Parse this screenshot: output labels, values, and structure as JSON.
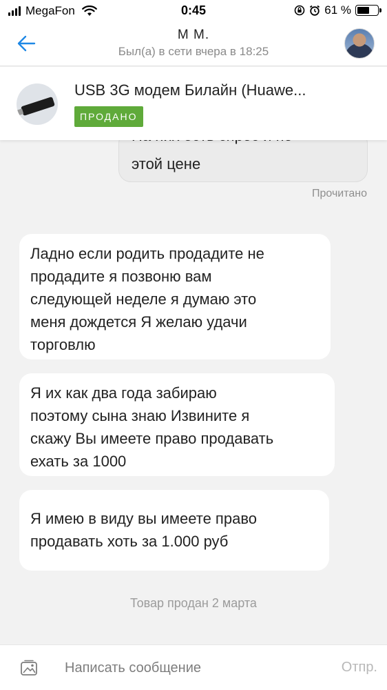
{
  "status_bar": {
    "carrier": "MegaFon",
    "time": "0:45",
    "battery": "61 %",
    "battery_level": 0.61
  },
  "header": {
    "title": "М М.",
    "subtitle": "Был(а) в сети вчера в 18:25"
  },
  "product": {
    "title": "USB 3G модем Билайн (Huawe...",
    "badge": "ПРОДАНО"
  },
  "messages": {
    "outgoing": {
      "line1": "На них есть спрос и по",
      "line2": "этой цене",
      "status": "Прочитано"
    },
    "incoming": [
      {
        "lines": [
          "Ладно если родить продадите не",
          "продадите я позвоню вам",
          "следующей неделе я думаю это",
          "меня дождется Я желаю удачи",
          "торговлю"
        ]
      },
      {
        "lines": [
          "Я их как два года забираю",
          "поэтому сына знаю Извините я",
          "скажу Вы имеете право продавать",
          "ехать за 1000"
        ]
      },
      {
        "lines": [
          "Я имею в виду вы имеете право",
          "продавать хоть за 1.000 руб"
        ]
      }
    ],
    "sold_note": "Товар продан 2 марта"
  },
  "composer": {
    "placeholder": "Написать сообщение",
    "send_label": "Отпр."
  },
  "colors": {
    "accent": "#1e88e5",
    "sold_badge": "#5faa3a"
  }
}
